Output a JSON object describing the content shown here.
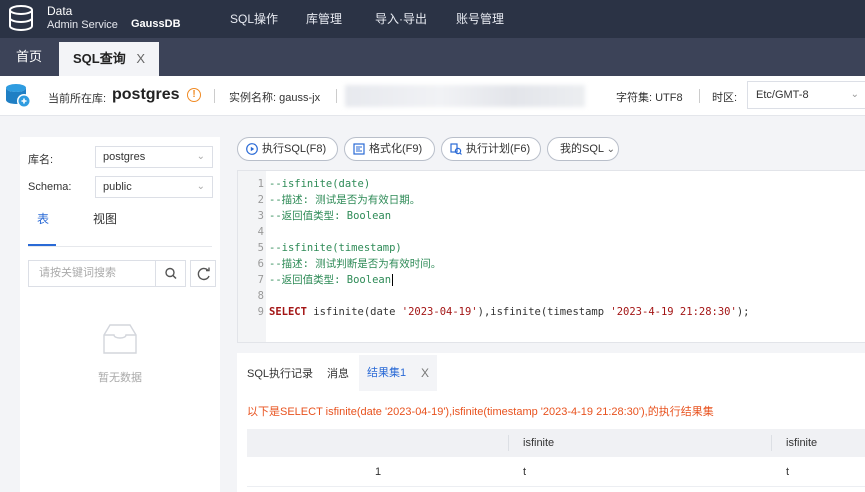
{
  "topnav": {
    "logo_line1": "Data",
    "logo_line2": "Admin Service",
    "logo_brand": "GaussDB",
    "menu": [
      "SQL操作",
      "库管理",
      "导入·导出",
      "账号管理"
    ]
  },
  "tabs": {
    "home": "首页",
    "sql": "SQL查询",
    "close": "X"
  },
  "infobar": {
    "current_db_label": "当前所在库:",
    "current_db": "postgres",
    "info_glyph": "!",
    "instance_label": "实例名称: gauss-jx",
    "charset": "字符集: UTF8",
    "timezone_label": "时区:",
    "timezone_value": "Etc/GMT-8"
  },
  "left": {
    "db_label": "库名:",
    "db_value": "postgres",
    "schema_label": "Schema:",
    "schema_value": "public",
    "tab_table": "表",
    "tab_view": "视图",
    "search_placeholder": "请按关键词搜索",
    "empty_text": "暂无数据"
  },
  "toolbar": {
    "execute": "执行SQL(F8)",
    "format": "格式化(F9)",
    "plan": "执行计划(F6)",
    "my_sql": "我的SQL"
  },
  "editor": {
    "lines": [
      {
        "n": "1",
        "text": "--isfinite(date)"
      },
      {
        "n": "2",
        "text": "--描述: 测试是否为有效日期。"
      },
      {
        "n": "3",
        "text": "--返回值类型: Boolean"
      },
      {
        "n": "4",
        "text": ""
      },
      {
        "n": "5",
        "text": "--isfinite(timestamp)"
      },
      {
        "n": "6",
        "text": "--描述: 测试判断是否为有效时间。"
      },
      {
        "n": "7",
        "text": "--返回值类型: Boolean"
      },
      {
        "n": "8",
        "text": ""
      },
      {
        "n": "9",
        "kw": "SELECT",
        "p1": " isfinite(date ",
        "s1": "'2023-04-19'",
        "p2": "),isfinite(timestamp ",
        "s2": "'2023-4-19 21:28:30'",
        "p3": ");"
      }
    ]
  },
  "result": {
    "tab_history": "SQL执行记录",
    "tab_messages": "消息",
    "tab_result": "结果集1",
    "tab_close": "X",
    "message": "以下是SELECT isfinite(date '2023-04-19'),isfinite(timestamp '2023-4-19 21:28:30'),的执行结果集",
    "columns": [
      "",
      "isfinite",
      "isfinite"
    ],
    "rows": [
      [
        "1",
        "t",
        "t"
      ]
    ]
  },
  "colors": {
    "topnav_bg": "#2b3345",
    "tabbar_bg": "#3c4358",
    "accent": "#2a6ad6",
    "comment": "#2e8b57",
    "keyword": "#a31515",
    "result_message": "#e8521e"
  }
}
